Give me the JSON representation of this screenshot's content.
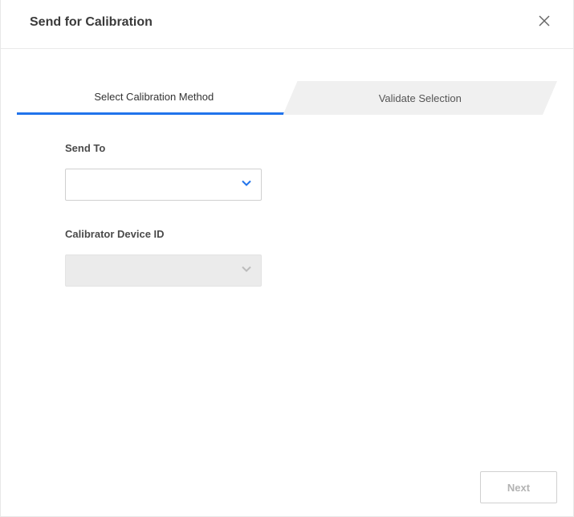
{
  "header": {
    "title": "Send for Calibration"
  },
  "steps": {
    "active": "Select Calibration Method",
    "next": "Validate Selection"
  },
  "form": {
    "send_to": {
      "label": "Send To",
      "value": ""
    },
    "device_id": {
      "label": "Calibrator Device ID",
      "value": ""
    }
  },
  "footer": {
    "next_label": "Next"
  }
}
